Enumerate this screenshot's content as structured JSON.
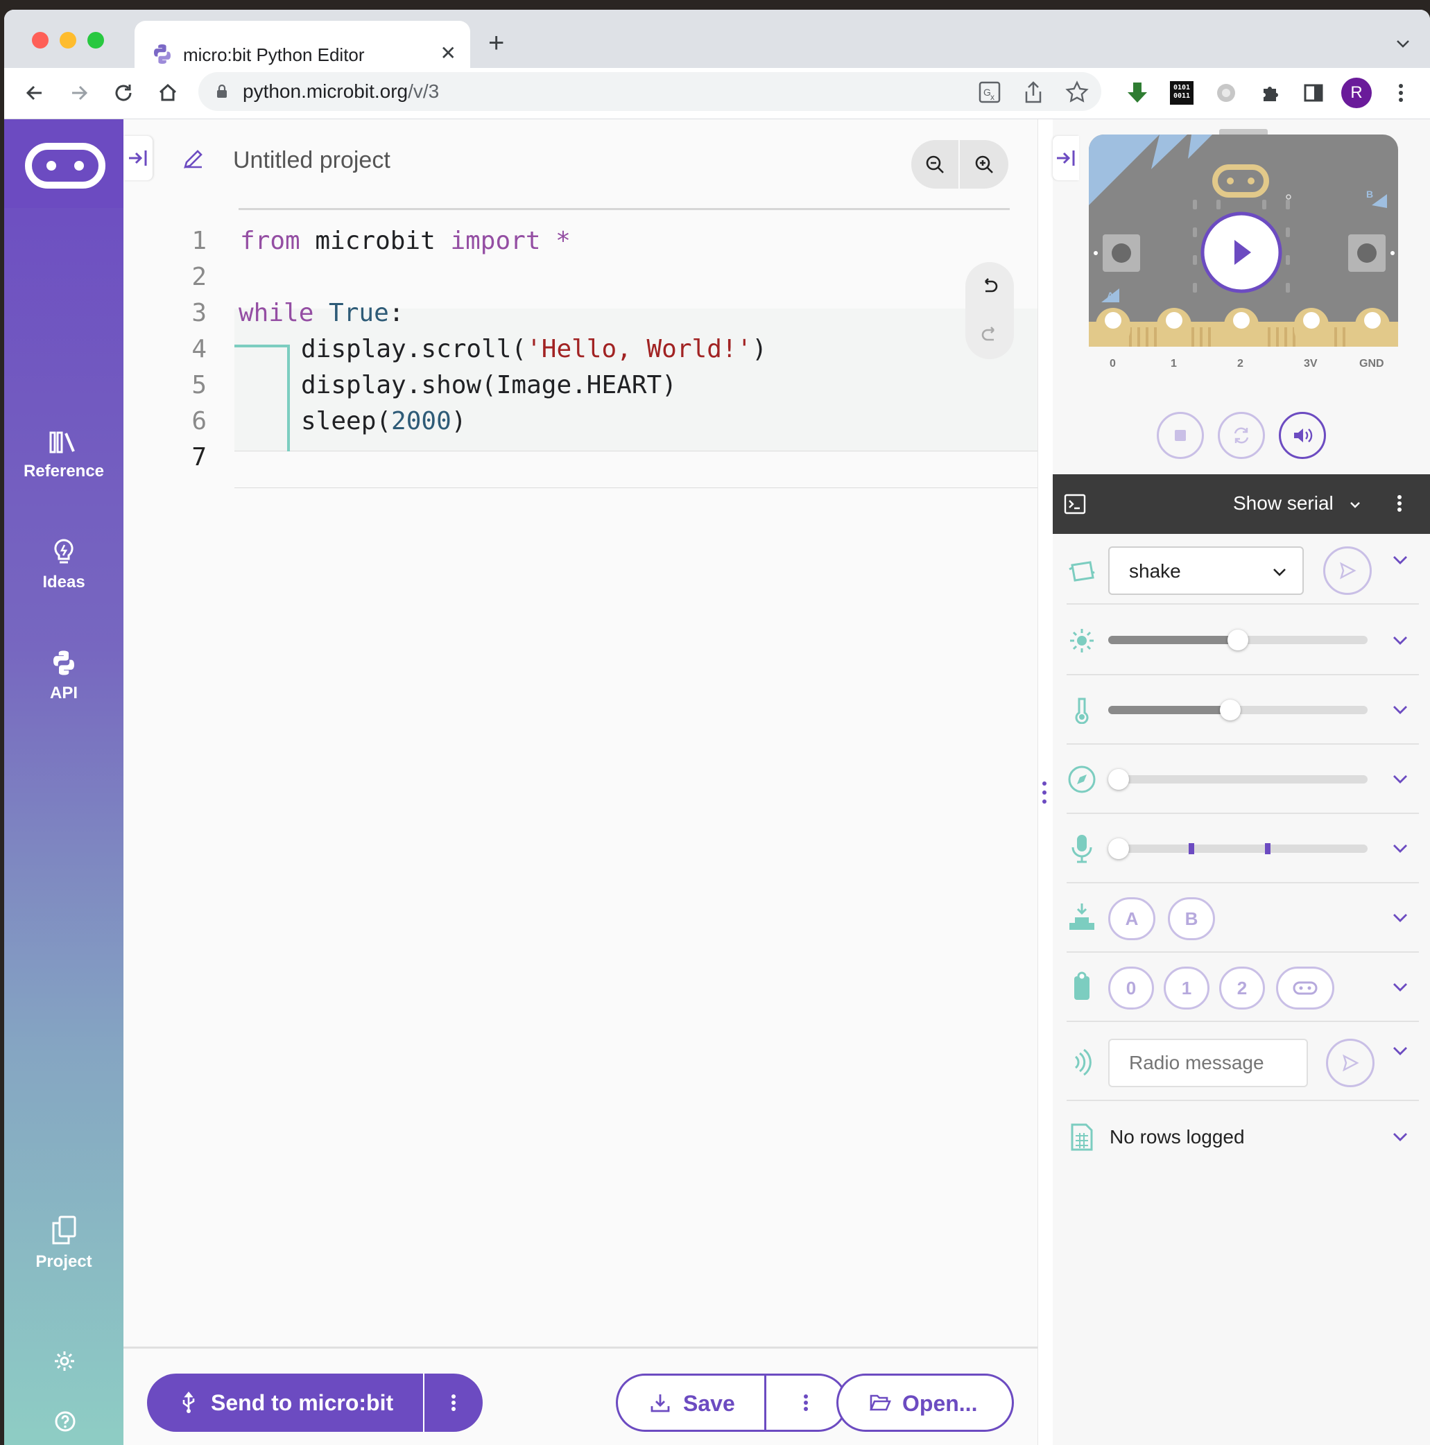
{
  "browser": {
    "tab_title": "micro:bit Python Editor",
    "url_host": "python.microbit.org",
    "url_path": "/v/3",
    "avatar_letter": "R",
    "ext_binary_line1": "0101",
    "ext_binary_line2": "0011"
  },
  "sidebar": {
    "items": [
      {
        "label": "Reference",
        "icon": "reference-icon"
      },
      {
        "label": "Ideas",
        "icon": "lightbulb-icon"
      },
      {
        "label": "API",
        "icon": "python-icon"
      },
      {
        "label": "Project",
        "icon": "files-icon"
      }
    ]
  },
  "editor": {
    "project_title": "Untitled project",
    "line_numbers": [
      "1",
      "2",
      "3",
      "4",
      "5",
      "6",
      "7"
    ],
    "code": {
      "l1_kw1": "from",
      "l1_mod": " microbit ",
      "l1_kw2": "import",
      "l1_star": " *",
      "l3_kw": "while",
      "l3_true": " True",
      "l3_colon": ":",
      "l4_pre": "display.scroll(",
      "l4_str": "'Hello, World!'",
      "l4_post": ")",
      "l5": "display.show(Image.HEART)",
      "l6_pre": "sleep(",
      "l6_num": "2000",
      "l6_post": ")"
    }
  },
  "actions": {
    "send_label": "Send to micro:bit",
    "save_label": "Save",
    "open_label": "Open..."
  },
  "simulator": {
    "pin_labels": [
      "0",
      "1",
      "2",
      "3V",
      "GND"
    ],
    "button_a_label": "A",
    "button_b_label": "B",
    "serial_label": "Show serial",
    "gesture_value": "shake",
    "light_level": 0.5,
    "temperature_level": 0.47,
    "compass_level": 0.0,
    "sound_level": 0.0,
    "buttons": [
      "A",
      "B"
    ],
    "pins": [
      "0",
      "1",
      "2"
    ],
    "radio_placeholder": "Radio message",
    "data_log_text": "No rows logged"
  },
  "colors": {
    "brand_purple": "#6c4bc1",
    "accent_teal": "#7ccdc0"
  }
}
